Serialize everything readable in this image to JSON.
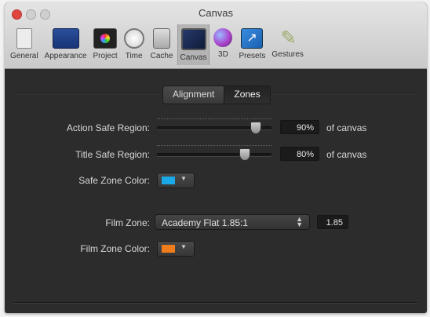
{
  "window": {
    "title": "Canvas"
  },
  "toolbar": {
    "items": [
      {
        "label": "General",
        "icon": "general-icon"
      },
      {
        "label": "Appearance",
        "icon": "appearance-icon"
      },
      {
        "label": "Project",
        "icon": "project-icon"
      },
      {
        "label": "Time",
        "icon": "time-icon"
      },
      {
        "label": "Cache",
        "icon": "cache-icon"
      },
      {
        "label": "Canvas",
        "icon": "canvas-icon",
        "active": true
      },
      {
        "label": "3D",
        "icon": "3d-icon"
      },
      {
        "label": "Presets",
        "icon": "presets-icon"
      },
      {
        "label": "Gestures",
        "icon": "gestures-icon"
      }
    ]
  },
  "tabs": {
    "alignment": "Alignment",
    "zones": "Zones",
    "selected": "Zones"
  },
  "zones": {
    "action_safe": {
      "label": "Action Safe Region:",
      "value": "90%",
      "fraction": 0.9,
      "unit": "of canvas"
    },
    "title_safe": {
      "label": "Title Safe Region:",
      "value": "80%",
      "fraction": 0.8,
      "unit": "of canvas"
    },
    "safe_zone_color": {
      "label": "Safe Zone Color:",
      "color": "#1aa8e6"
    },
    "film_zone": {
      "label": "Film Zone:",
      "selected": "Academy Flat 1.85:1",
      "ratio": "1.85"
    },
    "film_zone_color": {
      "label": "Film Zone Color:",
      "color": "#f07d1b"
    }
  }
}
